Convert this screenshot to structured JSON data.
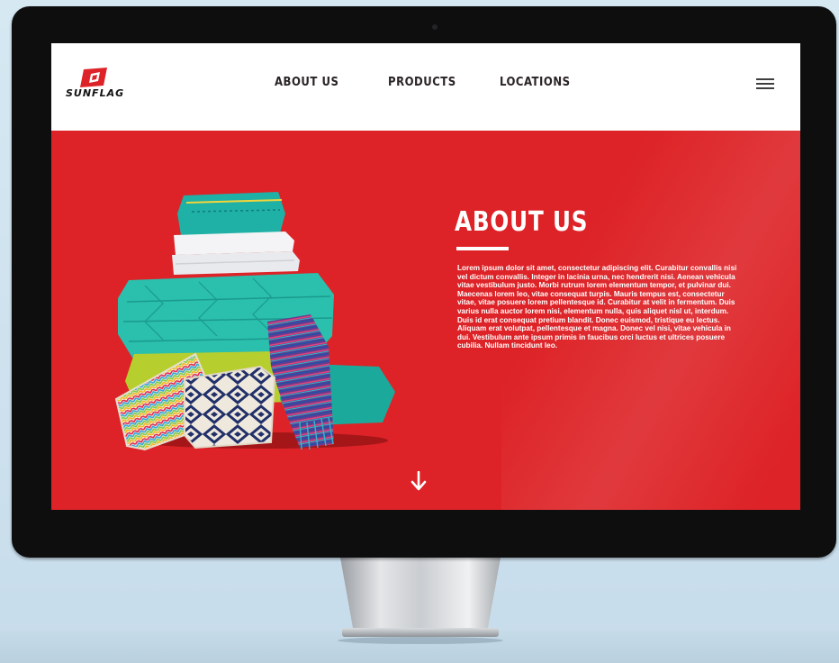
{
  "brand": {
    "name": "SUNFLAG"
  },
  "nav": {
    "about_label": "ABOUT US",
    "products_label": "PRODUCTS",
    "locations_label": "LOCATIONS",
    "menu_icon": "hamburger-menu-icon"
  },
  "hero": {
    "title": "ABOUT US",
    "body": "Lorem ipsum dolor sit amet, consectetur adipiscing elit. Curabitur convallis nisi vel dictum convallis. Integer in lacinia urna, nec hendrerit nisi. Aenean vehicula vitae vestibulum justo. Morbi rutrum lorem elementum tempor, et pulvinar dui. Maecenas lorem leo, vitae consequat turpis. Mauris tempus est, consectetur vitae, vitae posuere lorem pellentesque id. Curabitur at velit in fermentum. Duis varius nulla auctor lorem nisi, elementum nulla, quis aliquet nisl ut, interdum. Duis id erat consequat pretium blandit. Donec euismod, tristique eu lectus. Aliquam erat volutpat, pellentesque et magna. Donec vel nisi, vitae vehicula in dui. Vestibulum ante ipsum primis in faucibus orci luctus et ultrices posuere cubilia. Nullam tincidunt leo.",
    "scroll_icon": "arrow-down-icon",
    "image": "stacked-textiles-image"
  },
  "colors": {
    "hero_red": "#dd2327",
    "header_white": "#ffffff",
    "teal": "#23b3a6",
    "bezel": "#0e0e0f"
  }
}
